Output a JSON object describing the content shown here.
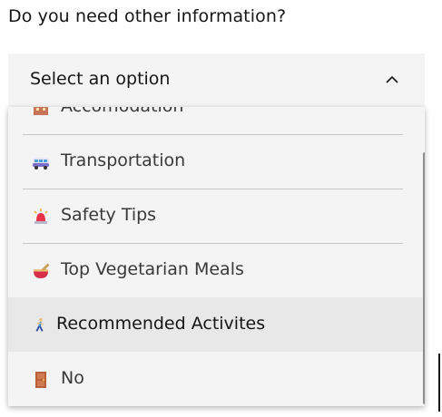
{
  "form": {
    "question": "Do you need other information?",
    "select": {
      "placeholder": "Select an option",
      "expanded": true
    }
  },
  "dropdown": {
    "options": [
      {
        "label": "Accomodation",
        "icon": "hotel-icon"
      },
      {
        "label": "Transportation",
        "icon": "minibus-icon"
      },
      {
        "label": "Safety Tips",
        "icon": "police-light-icon"
      },
      {
        "label": "Top Vegetarian Meals",
        "icon": "noodle-bowl-icon"
      },
      {
        "label": "Recommended Activites",
        "icon": "person-running-icon",
        "highlighted": true
      },
      {
        "label": "No",
        "icon": "door-icon"
      }
    ]
  },
  "colors": {
    "field_bg": "#f4f4f4",
    "highlight_bg": "#e8e8e8",
    "divider": "#c6c6c6",
    "text": "#161616"
  }
}
